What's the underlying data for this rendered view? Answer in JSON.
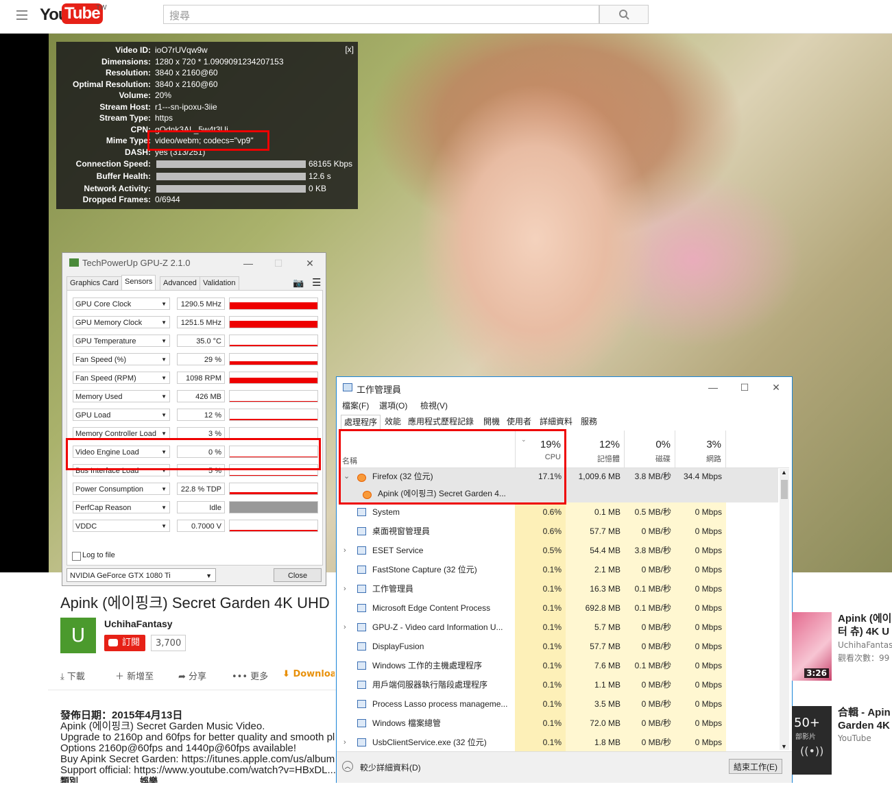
{
  "header": {
    "logo_you": "You",
    "logo_tube": "Tube",
    "logo_region": "TW",
    "search_placeholder": "搜尋"
  },
  "stats": {
    "close": "[x]",
    "rows": [
      {
        "label": "Video ID:",
        "value": "ioO7rUVqw9w"
      },
      {
        "label": "Dimensions:",
        "value": "1280 x 720 * 1.0909091234207153"
      },
      {
        "label": "Resolution:",
        "value": "3840 x 2160@60"
      },
      {
        "label": "Optimal Resolution:",
        "value": "3840 x 2160@60"
      },
      {
        "label": "Volume:",
        "value": "20%"
      },
      {
        "label": "Stream Host:",
        "value": "r1---sn-ipoxu-3iie"
      },
      {
        "label": "Stream Type:",
        "value": "https"
      },
      {
        "label": "CPN:",
        "value": "gOdnk3AL_5w4t3Ui"
      },
      {
        "label": "Mime Type:",
        "value": "video/webm; codecs=\"vp9\""
      },
      {
        "label": "DASH:",
        "value": "yes (313/251)"
      }
    ],
    "bars": [
      {
        "label": "Connection Speed:",
        "value": "68165 Kbps"
      },
      {
        "label": "Buffer Health:",
        "value": "12.6 s"
      },
      {
        "label": "Network Activity:",
        "value": "0 KB"
      }
    ],
    "dropped_label": "Dropped Frames:",
    "dropped_value": "0/6944"
  },
  "gpuz": {
    "title": "TechPowerUp GPU-Z 2.1.0",
    "tabs": [
      "Graphics Card",
      "Sensors",
      "Advanced",
      "Validation"
    ],
    "sensors": [
      {
        "name": "GPU Core Clock",
        "value": "1290.5 MHz",
        "level": 0.6
      },
      {
        "name": "GPU Memory Clock",
        "value": "1251.5 MHz",
        "level": 0.6
      },
      {
        "name": "GPU Temperature",
        "value": "35.0 °C",
        "level": 0.15
      },
      {
        "name": "Fan Speed (%)",
        "value": "29 %",
        "level": 0.29
      },
      {
        "name": "Fan Speed (RPM)",
        "value": "1098 RPM",
        "level": 0.5
      },
      {
        "name": "Memory Used",
        "value": "426 MB",
        "level": 0.05
      },
      {
        "name": "GPU Load",
        "value": "12 %",
        "level": 0.12
      },
      {
        "name": "Memory Controller Load",
        "value": "3 %",
        "level": 0.03
      },
      {
        "name": "Video Engine Load",
        "value": "0 %",
        "level": 0
      },
      {
        "name": "Bus Interface Load",
        "value": "5 %",
        "level": 0.05
      },
      {
        "name": "Power Consumption",
        "value": "22.8 % TDP",
        "level": 0.2
      },
      {
        "name": "PerfCap Reason",
        "value": "Idle",
        "level": 1
      },
      {
        "name": "VDDC",
        "value": "0.7000 V",
        "level": 0.12
      }
    ],
    "log_label": "Log to file",
    "device": "NVIDIA GeForce GTX 1080 Ti",
    "close": "Close"
  },
  "taskmgr": {
    "title": "工作管理員",
    "menu": [
      "檔案(F)",
      "選項(O)",
      "檢視(V)"
    ],
    "tabs": [
      "處理程序",
      "效能",
      "應用程式歷程記錄",
      "開機",
      "使用者",
      "詳細資料",
      "服務"
    ],
    "headers": {
      "name": "名稱",
      "cpu_pct": "19%",
      "cpu": "CPU",
      "mem_pct": "12%",
      "mem": "記憶體",
      "disk_pct": "0%",
      "disk": "磁碟",
      "net_pct": "3%",
      "net": "網路"
    },
    "processes": [
      {
        "name": "Firefox (32 位元)",
        "cpu": "17.1%",
        "mem": "1,009.6 MB",
        "disk": "3.8 MB/秒",
        "net": "34.4 Mbps",
        "exp": "v"
      },
      {
        "name": "Apink (에이핑크) Secret Garden 4...",
        "cpu": "",
        "mem": "",
        "disk": "",
        "net": "",
        "exp": ""
      },
      {
        "name": "System",
        "cpu": "0.6%",
        "mem": "0.1 MB",
        "disk": "0.5 MB/秒",
        "net": "0 Mbps",
        "exp": ""
      },
      {
        "name": "桌面視窗管理員",
        "cpu": "0.6%",
        "mem": "57.7 MB",
        "disk": "0 MB/秒",
        "net": "0 Mbps",
        "exp": ""
      },
      {
        "name": "ESET Service",
        "cpu": "0.5%",
        "mem": "54.4 MB",
        "disk": "3.8 MB/秒",
        "net": "0 Mbps",
        "exp": ">"
      },
      {
        "name": "FastStone Capture (32 位元)",
        "cpu": "0.1%",
        "mem": "2.1 MB",
        "disk": "0 MB/秒",
        "net": "0 Mbps",
        "exp": ""
      },
      {
        "name": "工作管理員",
        "cpu": "0.1%",
        "mem": "16.3 MB",
        "disk": "0.1 MB/秒",
        "net": "0 Mbps",
        "exp": ">"
      },
      {
        "name": "Microsoft Edge Content Process",
        "cpu": "0.1%",
        "mem": "692.8 MB",
        "disk": "0.1 MB/秒",
        "net": "0 Mbps",
        "exp": ""
      },
      {
        "name": "GPU-Z - Video card Information U...",
        "cpu": "0.1%",
        "mem": "5.7 MB",
        "disk": "0 MB/秒",
        "net": "0 Mbps",
        "exp": ">"
      },
      {
        "name": "DisplayFusion",
        "cpu": "0.1%",
        "mem": "57.7 MB",
        "disk": "0 MB/秒",
        "net": "0 Mbps",
        "exp": ""
      },
      {
        "name": "Windows 工作的主機處理程序",
        "cpu": "0.1%",
        "mem": "7.6 MB",
        "disk": "0.1 MB/秒",
        "net": "0 Mbps",
        "exp": ""
      },
      {
        "name": "用戶端伺服器執行階段處理程序",
        "cpu": "0.1%",
        "mem": "1.1 MB",
        "disk": "0 MB/秒",
        "net": "0 Mbps",
        "exp": ""
      },
      {
        "name": "Process Lasso process manageme...",
        "cpu": "0.1%",
        "mem": "3.5 MB",
        "disk": "0 MB/秒",
        "net": "0 Mbps",
        "exp": ""
      },
      {
        "name": "Windows 檔案總管",
        "cpu": "0.1%",
        "mem": "72.0 MB",
        "disk": "0 MB/秒",
        "net": "0 Mbps",
        "exp": ""
      },
      {
        "name": "UsbClientService.exe (32 位元)",
        "cpu": "0.1%",
        "mem": "1.8 MB",
        "disk": "0 MB/秒",
        "net": "0 Mbps",
        "exp": ">"
      }
    ],
    "fewer_details": "較少詳細資料(D)",
    "end_task": "結束工作(E)"
  },
  "video_page": {
    "title": "Apink (에이핑크) Secret Garden 4K UHD",
    "channel": "UchihaFantasy",
    "avatar_letter": "U",
    "subscribe": "訂閱",
    "sub_count": "3,700",
    "actions": [
      "下載",
      "新增至",
      "分享",
      "更多",
      "Download"
    ],
    "description": [
      "發佈日期：2015年4月13日",
      "Apink (에이핑크) Secret Garden Music Video.",
      "Upgrade to 2160p and 60fps for better quality and smooth pl",
      "Options 2160p@60fps and 1440p@60fps available!",
      "Buy Apink Secret Garden: https://itunes.apple.com/us/album",
      "Support official: https://www.youtube.com/watch?v=HBxDL..."
    ],
    "desc_tail": [
      "類別",
      "娛樂"
    ]
  },
  "sidebar": [
    {
      "title": "Apink (에이",
      "title2": "터 츄) 4K U",
      "sub": "UchihaFantas",
      "sub2": "觀看次數：99",
      "duration": "3:26"
    },
    {
      "title": "合輯 - Apin",
      "title2": "Garden 4K",
      "sub": "YouTube",
      "badge": "50+",
      "badge_sub": "部影片"
    }
  ]
}
